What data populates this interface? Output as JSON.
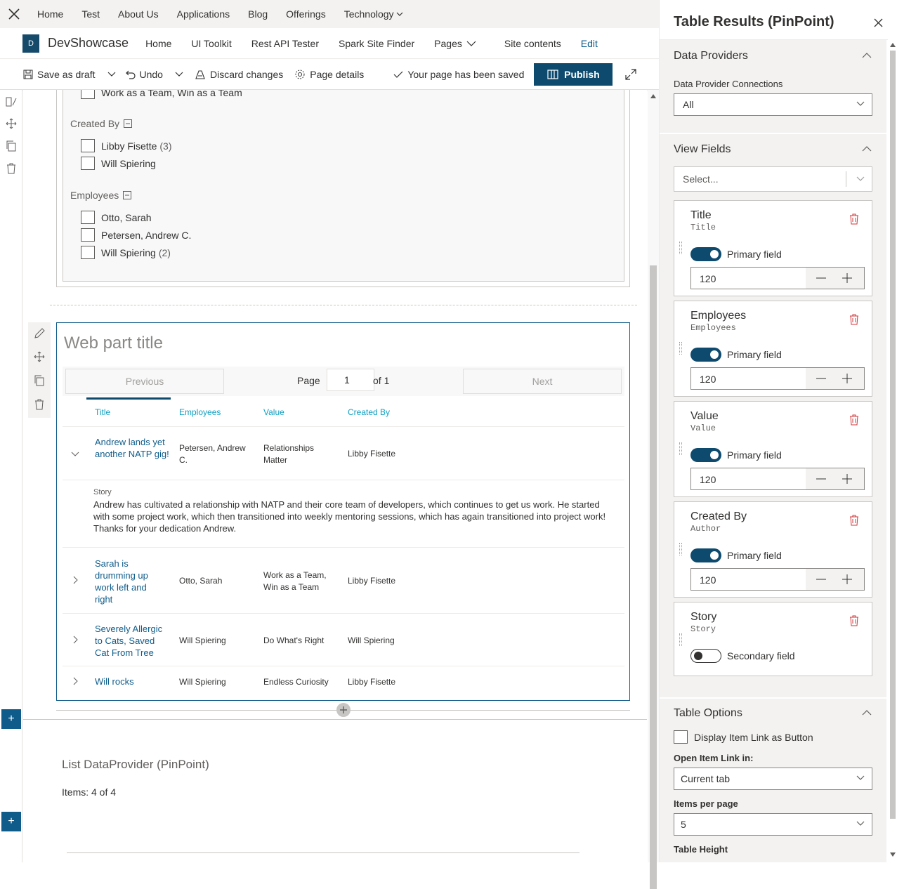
{
  "top_nav": {
    "items": [
      "Home",
      "Test",
      "About Us",
      "Applications",
      "Blog",
      "Offerings",
      "Technology"
    ]
  },
  "site_bar": {
    "logo_letter": "D",
    "site_name": "DevShowcase",
    "items": [
      "Home",
      "UI Toolkit",
      "Rest API Tester",
      "Spark Site Finder",
      "Pages",
      "Site contents",
      "Edit"
    ]
  },
  "command_bar": {
    "save_draft": "Save as draft",
    "undo": "Undo",
    "discard": "Discard changes",
    "page_details": "Page details",
    "saved_status": "Your page has been saved",
    "publish": "Publish"
  },
  "filters": {
    "partial_item": "Work as a Team, Win as a Team",
    "created_by": {
      "label": "Created By",
      "items": [
        {
          "name": "Libby Fisette",
          "count": "(3)"
        },
        {
          "name": "Will Spiering",
          "count": ""
        }
      ]
    },
    "employees": {
      "label": "Employees",
      "items": [
        {
          "name": "Otto, Sarah",
          "count": ""
        },
        {
          "name": "Petersen, Andrew C.",
          "count": ""
        },
        {
          "name": "Will Spiering",
          "count": "(2)"
        }
      ]
    }
  },
  "webpart": {
    "title_placeholder": "Web part title",
    "pager": {
      "previous": "Previous",
      "page_label": "Page",
      "page_value": "1",
      "of_label": "of 1",
      "next": "Next"
    },
    "columns": [
      "Title",
      "Employees",
      "Value",
      "Created By"
    ],
    "rows": [
      {
        "title": "Andrew lands yet another NATP gig!",
        "employees": "Petersen, Andrew C.",
        "value": "Relationships Matter",
        "created_by": "Libby Fisette",
        "expanded": true
      },
      {
        "title": "Sarah is drumming up work left and right",
        "employees": "Otto, Sarah",
        "value": "Work as a Team, Win as a Team",
        "created_by": "Libby Fisette",
        "expanded": false
      },
      {
        "title": "Severely Allergic to Cats, Saved Cat From Tree",
        "employees": "Will Spiering",
        "value": "Do What's Right",
        "created_by": "Will Spiering",
        "expanded": false
      },
      {
        "title": "Will rocks",
        "employees": "Will Spiering",
        "value": "Endless Curiosity",
        "created_by": "Libby Fisette",
        "expanded": false
      }
    ],
    "story_label": "Story",
    "story_text": "Andrew has cultivated a relationship with NATP and their core team of developers, which continues to get us work. He started with some project work, which then transitioned into weekly mentoring sessions, which has again transitioned into project work! Thanks for your dedication Andrew."
  },
  "list_provider": {
    "title": "List DataProvider (PinPoint)",
    "items_text": "Items: 4 of 4"
  },
  "pane": {
    "title": "Table Results (PinPoint)",
    "data_providers": {
      "heading": "Data Providers",
      "connections_label": "Data Provider Connections",
      "connections_value": "All"
    },
    "view_fields": {
      "heading": "View Fields",
      "select_placeholder": "Select...",
      "fields": [
        {
          "name": "Title",
          "internal": "Title",
          "toggle_label": "Primary field",
          "on": true,
          "width": "120"
        },
        {
          "name": "Employees",
          "internal": "Employees",
          "toggle_label": "Primary field",
          "on": true,
          "width": "120"
        },
        {
          "name": "Value",
          "internal": "Value",
          "toggle_label": "Primary field",
          "on": true,
          "width": "120"
        },
        {
          "name": "Created By",
          "internal": "Author",
          "toggle_label": "Primary field",
          "on": true,
          "width": "120"
        },
        {
          "name": "Story",
          "internal": "Story",
          "toggle_label": "Secondary field",
          "on": false,
          "width": ""
        }
      ]
    },
    "table_options": {
      "heading": "Table Options",
      "link_button_label": "Display Item Link as Button",
      "open_link_label": "Open Item Link in:",
      "open_link_value": "Current tab",
      "items_per_page_label": "Items per page",
      "items_per_page_value": "5",
      "table_height_label": "Table Height"
    }
  },
  "colors": {
    "accent": "#0d4a6e",
    "link": "#0f5c8a",
    "column_header": "#0f9fc0",
    "delete": "#d13438"
  }
}
